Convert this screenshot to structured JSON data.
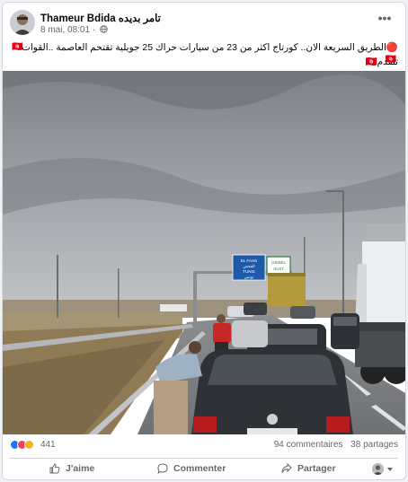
{
  "post": {
    "author": "Thameur Bdida تامر بديده",
    "timestamp": "8 mai, 08:01",
    "flag_leading": "🇹🇳",
    "text": "🔴الطريق السريعة الان.. كورتاج اكثر من 23 من سيارات حراك 25 جويلية تقتحم العاصمة ..القوات تتقدم🇹🇳",
    "flag_trailing": "🇹🇳"
  },
  "photo": {
    "sign_left_line1": "EL FAHS",
    "sign_left_line2": "الفحص",
    "sign_left_line3": "TUNIS",
    "sign_left_line4": "تونس",
    "sign_right_line1": "DJEBEL",
    "sign_right_line2": "OUST",
    "plate": ""
  },
  "stats": {
    "reaction_count": "441",
    "comments": "94 commentaires",
    "shares": "38 partages"
  },
  "actions": {
    "like": "J'aime",
    "comment": "Commenter",
    "share": "Partager"
  },
  "colors": {
    "like_blue": "#1877f2",
    "love_red": "#f33e58",
    "haha_yellow": "#f7b125",
    "sign_blue": "#1f5aa6",
    "sign_green": "#2e7d32"
  }
}
